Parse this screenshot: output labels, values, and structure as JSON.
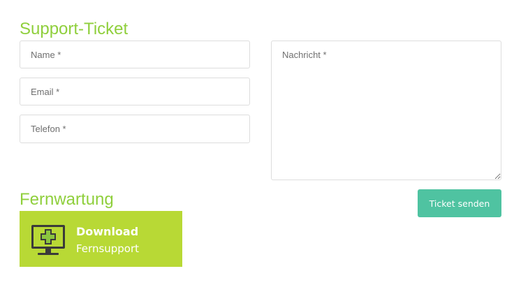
{
  "colors": {
    "heading": "#8fcf3c",
    "button_bg": "#4fc3a1",
    "banner_bg": "#b8d935",
    "icon_dark": "#3a3a3a",
    "icon_cross": "#8bc53f"
  },
  "support": {
    "title": "Support-Ticket",
    "name_placeholder": "Name *",
    "email_placeholder": "Email *",
    "phone_placeholder": "Telefon *",
    "message_placeholder": "Nachricht *",
    "submit_label": "Ticket senden"
  },
  "remote": {
    "title": "Fernwartung",
    "download_title": "Download",
    "download_subtitle": "Fernsupport",
    "icon": "monitor-plus-icon"
  }
}
